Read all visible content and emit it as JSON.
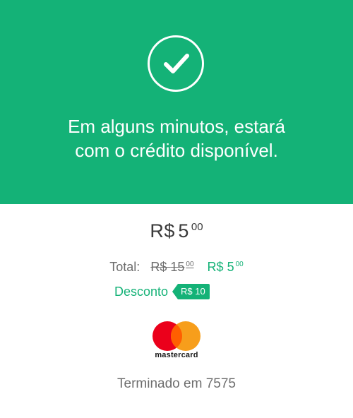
{
  "colors": {
    "brand_green": "#14b277",
    "mastercard_red": "#eb001b",
    "mastercard_yellow": "#f79e1b",
    "mastercard_orange": "#ff5f00"
  },
  "hero": {
    "icon": "check-icon",
    "message_line1": "Em alguns minutos, estará",
    "message_line2": "com o crédito disponível."
  },
  "amount": {
    "currency": "R$",
    "integer": "5",
    "cents": "00"
  },
  "total": {
    "label": "Total:",
    "original_currency": "R$",
    "original_integer": "15",
    "original_cents": "00",
    "final_currency": "R$",
    "final_integer": "5",
    "final_cents": "00"
  },
  "discount": {
    "label": "Desconto",
    "value": "R$ 10"
  },
  "payment": {
    "brand_icon": "mastercard-logo",
    "brand_word": "mastercard",
    "ending_text": "Terminado em 7575"
  }
}
